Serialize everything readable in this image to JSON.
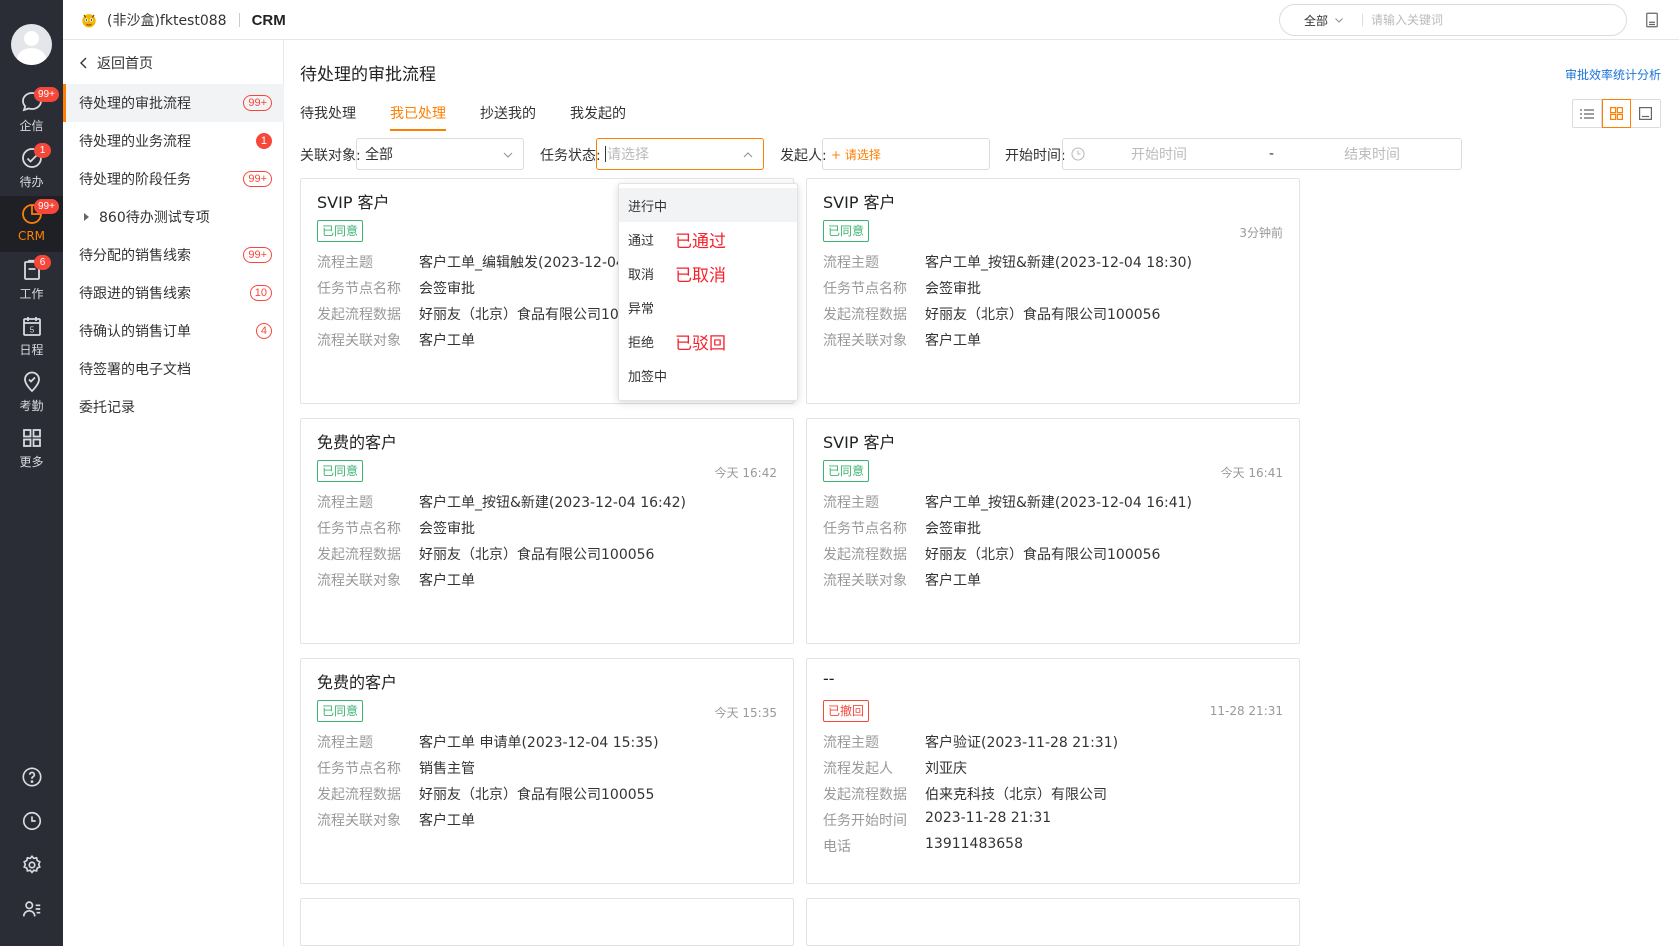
{
  "rail": {
    "items": [
      {
        "label": "企信",
        "badge": "99+",
        "icon": "chat-bubble-icon"
      },
      {
        "label": "待办",
        "badge": "1",
        "icon": "check-circle-icon"
      },
      {
        "label": "CRM",
        "badge": "99+",
        "icon": "pie-chart-icon"
      },
      {
        "label": "工作",
        "badge": "6",
        "icon": "clipboard-icon"
      },
      {
        "label": "日程",
        "badge": "",
        "icon": "calendar-icon"
      },
      {
        "label": "考勤",
        "badge": "",
        "icon": "location-check-icon"
      },
      {
        "label": "更多",
        "badge": "",
        "icon": "grid-icon"
      }
    ],
    "calendar_day": "5",
    "bottom_icons": [
      "help-icon",
      "history-clock-icon",
      "settings-gear-icon",
      "user-list-icon"
    ]
  },
  "header": {
    "company": "(非沙盒)fktest088",
    "app": "CRM",
    "search_scope": "全部",
    "search_placeholder": "请输入关键词"
  },
  "sidebar": {
    "back_label": "返回首页",
    "items": [
      {
        "label": "待处理的审批流程",
        "badge": "99+",
        "badge_style": "outline"
      },
      {
        "label": "待处理的业务流程",
        "badge": "1",
        "badge_style": "solid"
      },
      {
        "label": "待处理的阶段任务",
        "badge": "99+",
        "badge_style": "outline"
      },
      {
        "label": "860待办测试专项",
        "badge": "",
        "badge_style": "none"
      },
      {
        "label": "待分配的销售线索",
        "badge": "99+",
        "badge_style": "outline"
      },
      {
        "label": "待跟进的销售线索",
        "badge": "10",
        "badge_style": "outline"
      },
      {
        "label": "待确认的销售订单",
        "badge": "4",
        "badge_style": "outline"
      },
      {
        "label": "待签署的电子文档",
        "badge": "",
        "badge_style": "none"
      },
      {
        "label": "委托记录",
        "badge": "",
        "badge_style": "none"
      }
    ]
  },
  "main": {
    "title": "待处理的审批流程",
    "stat_link": "审批效率统计分析",
    "tabs": [
      "待我处理",
      "我已处理",
      "抄送我的",
      "我发起的"
    ],
    "active_tab": 1,
    "filters": {
      "related_label": "关联对象:",
      "related_value": "全部",
      "status_label": "任务状态:",
      "status_placeholder": "请选择",
      "initiator_label": "发起人:",
      "initiator_value": "+ 请选择",
      "start_label": "开始时间:",
      "start_placeholder": "开始时间",
      "range_sep": "-",
      "end_placeholder": "结束时间"
    },
    "dropdown": {
      "options": [
        "进行中",
        "通过",
        "取消",
        "异常",
        "拒绝",
        "加签中"
      ],
      "notes": {
        "1": "已通过",
        "2": "已取消",
        "4": "已驳回"
      }
    },
    "cards": [
      {
        "title": "SVIP 客户",
        "status": "已同意",
        "time": "",
        "rows": [
          {
            "k": "流程主题",
            "v": "客户工单_编辑触发(2023-12-04"
          },
          {
            "k": "任务节点名称",
            "v": "会签审批"
          },
          {
            "k": "发起流程数据",
            "v": "好丽友（北京）食品有限公司10"
          },
          {
            "k": "流程关联对象",
            "v": "客户工单"
          }
        ]
      },
      {
        "title": "SVIP 客户",
        "status": "已同意",
        "time": "3分钟前",
        "rows": [
          {
            "k": "流程主题",
            "v": "客户工单_按钮&新建(2023-12-04 18:30)"
          },
          {
            "k": "任务节点名称",
            "v": "会签审批"
          },
          {
            "k": "发起流程数据",
            "v": "好丽友（北京）食品有限公司100056"
          },
          {
            "k": "流程关联对象",
            "v": "客户工单"
          }
        ]
      },
      {
        "title": "免费的客户",
        "status": "已同意",
        "time": "今天 16:42",
        "rows": [
          {
            "k": "流程主题",
            "v": "客户工单_按钮&新建(2023-12-04 16:42)"
          },
          {
            "k": "任务节点名称",
            "v": "会签审批"
          },
          {
            "k": "发起流程数据",
            "v": "好丽友（北京）食品有限公司100056"
          },
          {
            "k": "流程关联对象",
            "v": "客户工单"
          }
        ]
      },
      {
        "title": "SVIP 客户",
        "status": "已同意",
        "time": "今天 16:41",
        "rows": [
          {
            "k": "流程主题",
            "v": "客户工单_按钮&新建(2023-12-04 16:41)"
          },
          {
            "k": "任务节点名称",
            "v": "会签审批"
          },
          {
            "k": "发起流程数据",
            "v": "好丽友（北京）食品有限公司100056"
          },
          {
            "k": "流程关联对象",
            "v": "客户工单"
          }
        ]
      },
      {
        "title": "免费的客户",
        "status": "已同意",
        "time": "今天 15:35",
        "rows": [
          {
            "k": "流程主题",
            "v": "客户工单 申请单(2023-12-04 15:35)"
          },
          {
            "k": "任务节点名称",
            "v": "销售主管"
          },
          {
            "k": "发起流程数据",
            "v": "好丽友（北京）食品有限公司100055"
          },
          {
            "k": "流程关联对象",
            "v": "客户工单"
          }
        ]
      },
      {
        "title": "--",
        "status": "已撤回",
        "time": "11-28 21:31",
        "rows": [
          {
            "k": "流程主题",
            "v": "客户验证(2023-11-28 21:31)"
          },
          {
            "k": "流程发起人",
            "v": "刘亚庆"
          },
          {
            "k": "发起流程数据",
            "v": "伯来克科技（北京）有限公司"
          },
          {
            "k": "任务开始时间",
            "v": "2023-11-28 21:31"
          },
          {
            "k": "电话",
            "v": "13911483658"
          }
        ]
      }
    ]
  },
  "colors": {
    "accent": "#ff8000",
    "approved": "#3cb371",
    "revoked": "#f5483b",
    "link": "#1a73d9",
    "rail": "#2a2d35"
  }
}
